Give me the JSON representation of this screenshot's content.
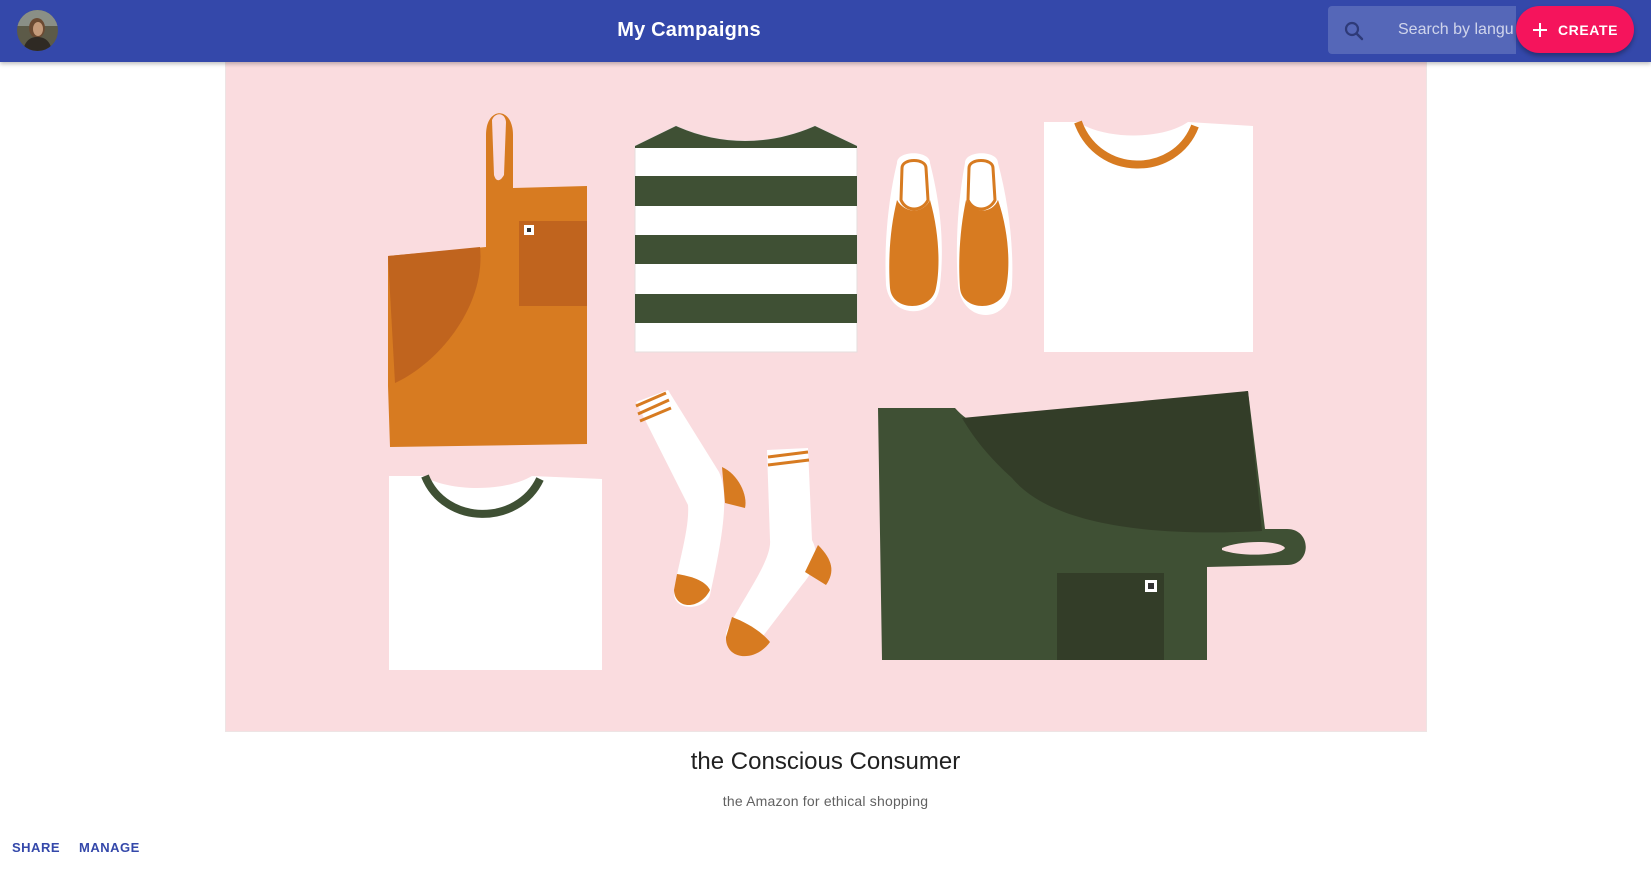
{
  "appbar": {
    "title": "My Campaigns",
    "avatar_icon": "user-avatar",
    "search": {
      "placeholder": "Search by language",
      "value": "",
      "icon": "search-icon"
    },
    "create": {
      "label": "CREATE",
      "icon": "plus-icon"
    },
    "colors": {
      "bar": "#3448aa",
      "create_button": "#f5145c"
    }
  },
  "campaign": {
    "image_icon": "apparel-flatlay-illustration",
    "title": "the Conscious Consumer",
    "subtitle": "the Amazon for ethical shopping",
    "actions": {
      "share": "SHARE",
      "manage": "MANAGE"
    },
    "colors": {
      "background": "#fadcdf",
      "orange": "#d77b21",
      "green": "#3f5034"
    }
  }
}
